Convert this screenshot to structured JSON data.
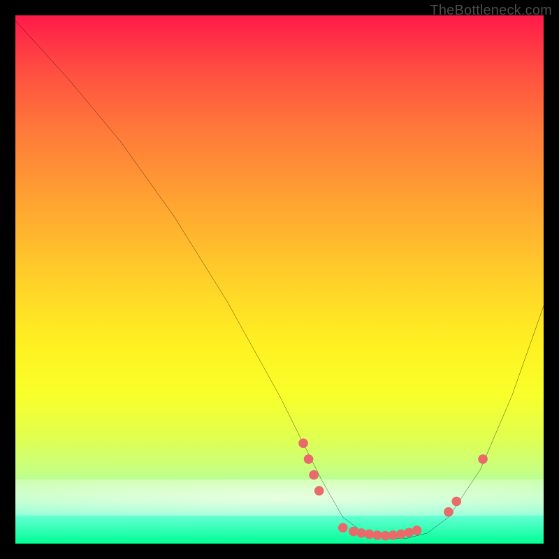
{
  "attribution": "TheBottleneck.com",
  "chart_data": {
    "type": "line",
    "title": "",
    "xlabel": "",
    "ylabel": "",
    "x_range": [
      0,
      100
    ],
    "y_range": [
      0,
      100
    ],
    "gradient_meaning": "vertical: green (bottom, 0% bottleneck) to red (top, 100% bottleneck)",
    "series": [
      {
        "name": "bottleneck-curve",
        "x": [
          0,
          10,
          20,
          30,
          40,
          50,
          54,
          58,
          62,
          66,
          70,
          74,
          78,
          82,
          88,
          94,
          100
        ],
        "y": [
          99,
          88,
          76,
          62,
          46,
          28,
          20,
          12,
          5,
          2,
          1,
          1,
          2,
          5,
          14,
          28,
          45
        ]
      }
    ],
    "markers": [
      {
        "x": 54.5,
        "y": 19
      },
      {
        "x": 55.5,
        "y": 16
      },
      {
        "x": 56.5,
        "y": 13
      },
      {
        "x": 57.5,
        "y": 10
      },
      {
        "x": 62,
        "y": 3
      },
      {
        "x": 64,
        "y": 2.3
      },
      {
        "x": 65.5,
        "y": 2
      },
      {
        "x": 67,
        "y": 1.8
      },
      {
        "x": 68.5,
        "y": 1.6
      },
      {
        "x": 70,
        "y": 1.5
      },
      {
        "x": 71.5,
        "y": 1.6
      },
      {
        "x": 73,
        "y": 1.8
      },
      {
        "x": 74.5,
        "y": 2.1
      },
      {
        "x": 76,
        "y": 2.5
      },
      {
        "x": 82,
        "y": 6
      },
      {
        "x": 83.5,
        "y": 8
      },
      {
        "x": 88.5,
        "y": 16
      }
    ],
    "marker_color": "#e86a6a",
    "curve_color": "#000000"
  }
}
